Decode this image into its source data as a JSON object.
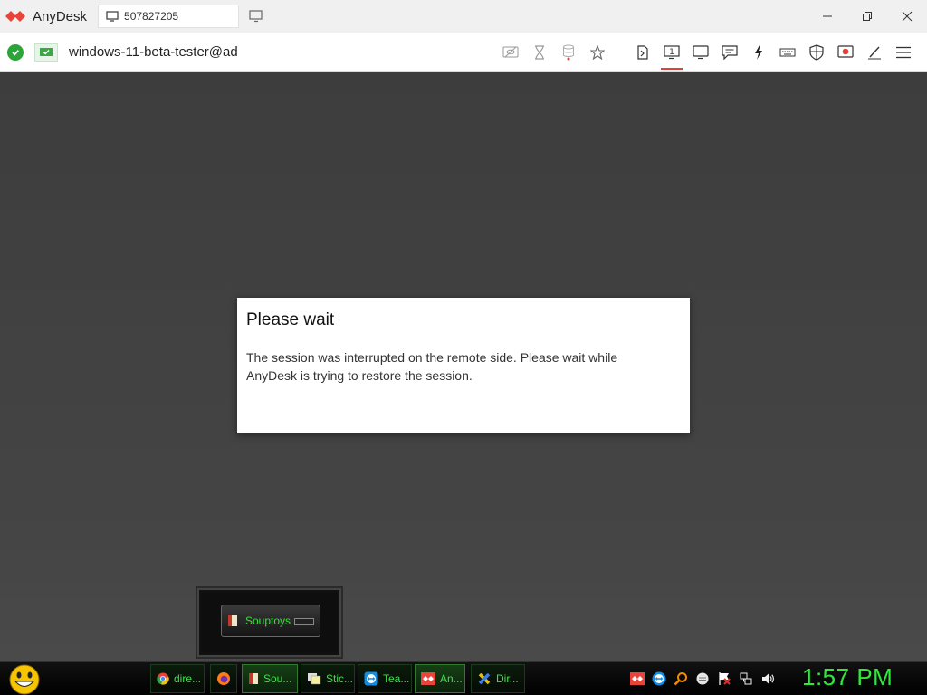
{
  "app": {
    "name": "AnyDesk",
    "brand_color": "#e8443a"
  },
  "tab": {
    "label": "507827205",
    "icon": "monitor-icon"
  },
  "window_controls": [
    "minimize-icon",
    "restore-icon",
    "close-icon"
  ],
  "toolbar": {
    "address": "windows-11-beta-tester@ad",
    "status_color": "#2ba53a",
    "tools_left": [
      "hidden-view-icon",
      "hourglass-icon",
      "database-icon",
      "star-icon"
    ],
    "tools_right": [
      "file-transfer-icon",
      "display-one-icon",
      "monitor-icon",
      "chat-icon",
      "lightning-icon",
      "keyboard-icon",
      "shield-icon",
      "record-icon",
      "pen-icon",
      "hamburger-menu-icon"
    ],
    "active_tool": "display-one-icon"
  },
  "dialog": {
    "title": "Please wait",
    "message": "The session was interrupted on the remote side. Please wait while AnyDesk is trying to restore the session."
  },
  "gadget": {
    "label": "Souptoys"
  },
  "taskbar": {
    "items": [
      {
        "label": "dire...",
        "icon": "chrome-icon"
      },
      {
        "label": "",
        "icon": "firefox-icon"
      },
      {
        "label": "Sou...",
        "icon": "souptoys-icon"
      },
      {
        "label": "Stic...",
        "icon": "sticky-notes-icon"
      },
      {
        "label": "Tea...",
        "icon": "teamviewer-icon"
      },
      {
        "label": "An...",
        "icon": "anydesk-icon"
      },
      {
        "label": "Dir...",
        "icon": "directx-icon"
      }
    ],
    "tray_icons": [
      "anydesk-tray-icon",
      "teamviewer-tray-icon",
      "search-tray-icon",
      "circle-tray-icon",
      "flag-tray-icon",
      "network-icon",
      "volume-icon"
    ],
    "clock": "1:57 PM",
    "accent": "#2ee83a"
  }
}
